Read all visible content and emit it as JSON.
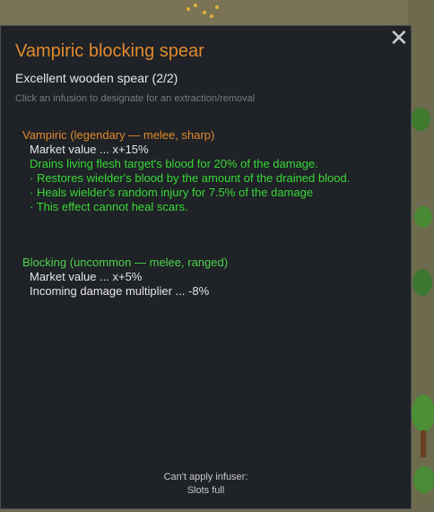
{
  "dialog": {
    "title": "Vampiric blocking spear",
    "subtitle": "Excellent wooden spear (2/2)",
    "hint": "Click an infusion to designate for an extraction/removal",
    "close_glyph": "✕"
  },
  "infusions": [
    {
      "header": "Vampiric (legendary — melee, sharp)",
      "header_color": "#e08a2e",
      "market_value": "Market value ... x+15%",
      "effect": "Drains living flesh target's blood for 20% of the damage.",
      "sub_effects": [
        "· Restores wielder's blood by the amount of the drained blood.",
        "· Heals wielder's random injury for 7.5% of the damage",
        "· This effect cannot heal scars."
      ]
    },
    {
      "header": "Blocking (uncommon — melee, ranged)",
      "header_color": "#4ed34e",
      "market_value": "Market value ... x+5%",
      "stat": "Incoming damage multiplier ... -8%"
    }
  ],
  "footer": {
    "line1": "Can't apply infuser:",
    "line2": "Slots full"
  }
}
